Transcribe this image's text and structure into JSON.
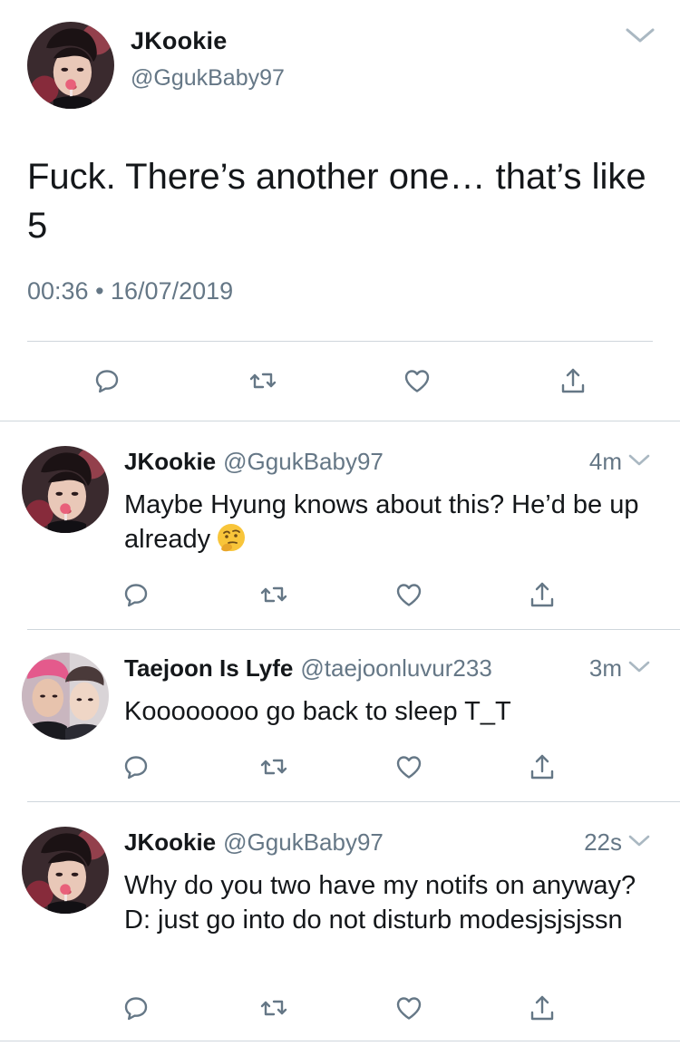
{
  "main_tweet": {
    "name": "JKookie",
    "handle": "@GgukBaby97",
    "text": "Fuck. There’s another one… that’s like 5",
    "timestamp": "00:36 • 16/07/2019",
    "avatar": "avatar-photo"
  },
  "replies": [
    {
      "name": "JKookie",
      "handle": "@GgukBaby97",
      "time": "4m",
      "text": "Maybe Hyung knows about this? He’d be up already",
      "emoji": "thinking-face-emoji"
    },
    {
      "name": "Taejoon Is Lyfe",
      "handle": "@taejoonluvur233",
      "time": "3m",
      "text": "Koooooooo go back to sleep T_T"
    },
    {
      "name": "JKookie",
      "handle": "@GgukBaby97",
      "time": "22s",
      "text": "Why do you two have my notifs on anyway? D: just go into do not disturb modesjsjsjssn"
    }
  ],
  "actions": [
    "reply-icon",
    "retweet-icon",
    "like-icon",
    "share-icon"
  ],
  "colors": {
    "text": "#14171a",
    "secondary": "#657786",
    "divider": "#cfd6dc"
  }
}
